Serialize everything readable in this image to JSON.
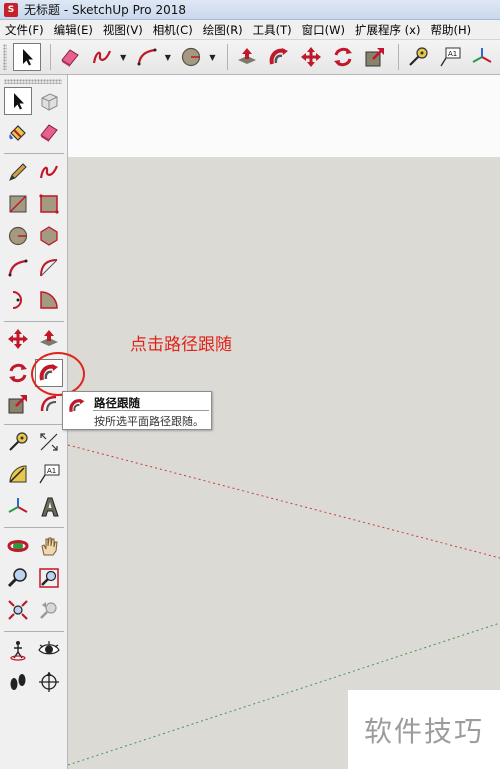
{
  "window": {
    "title": "无标题 - SketchUp Pro 2018",
    "app_icon": "sketchup-logo-icon"
  },
  "menubar": {
    "items": [
      "文件(F)",
      "编辑(E)",
      "视图(V)",
      "相机(C)",
      "绘图(R)",
      "工具(T)",
      "窗口(W)",
      "扩展程序 (x)",
      "帮助(H)"
    ]
  },
  "top_toolbar": {
    "buttons": [
      "select-arrow-icon",
      "eraser-icon",
      "freehand-icon",
      "arc-icon",
      "circle-icon",
      "push-pull-icon",
      "follow-me-icon",
      "move-icon",
      "rotate-icon",
      "scale-icon",
      "tape-measure-icon",
      "text-icon"
    ]
  },
  "left_toolbar": {
    "buttons": [
      "select-arrow-icon",
      "make-component-icon",
      "paint-bucket-icon",
      "eraser-icon",
      "pencil-icon",
      "freehand-icon",
      "rectangle-icon",
      "rotated-rectangle-icon",
      "circle-icon",
      "polygon-icon",
      "arc-icon",
      "two-point-arc-icon",
      "three-point-arc-icon",
      "pie-icon",
      "move-icon",
      "push-pull-icon",
      "rotate-icon",
      "follow-me-icon",
      "scale-icon",
      "offset-icon",
      "tape-measure-icon",
      "dimension-icon",
      "protractor-icon",
      "text-icon",
      "axes-icon",
      "3d-text-icon",
      "orbit-icon",
      "pan-icon",
      "zoom-icon",
      "zoom-window-icon",
      "zoom-extents-icon",
      "previous-view-icon",
      "position-camera-icon",
      "look-around-icon",
      "walk-icon",
      "section-plane-icon"
    ],
    "active": "follow-me-icon"
  },
  "annotation": {
    "text": "点击路径跟随",
    "color": "#e0241c"
  },
  "tooltip": {
    "title": "路径跟随",
    "description": "按所选平面路径跟随。"
  },
  "watermark": {
    "text": "软件技巧"
  },
  "colors": {
    "canvas": "#dcdad5",
    "sky": "#fbfbfb",
    "accent_red": "#e0241c",
    "x_axis": "#c83c3c",
    "y_axis": "#3c9a50"
  }
}
